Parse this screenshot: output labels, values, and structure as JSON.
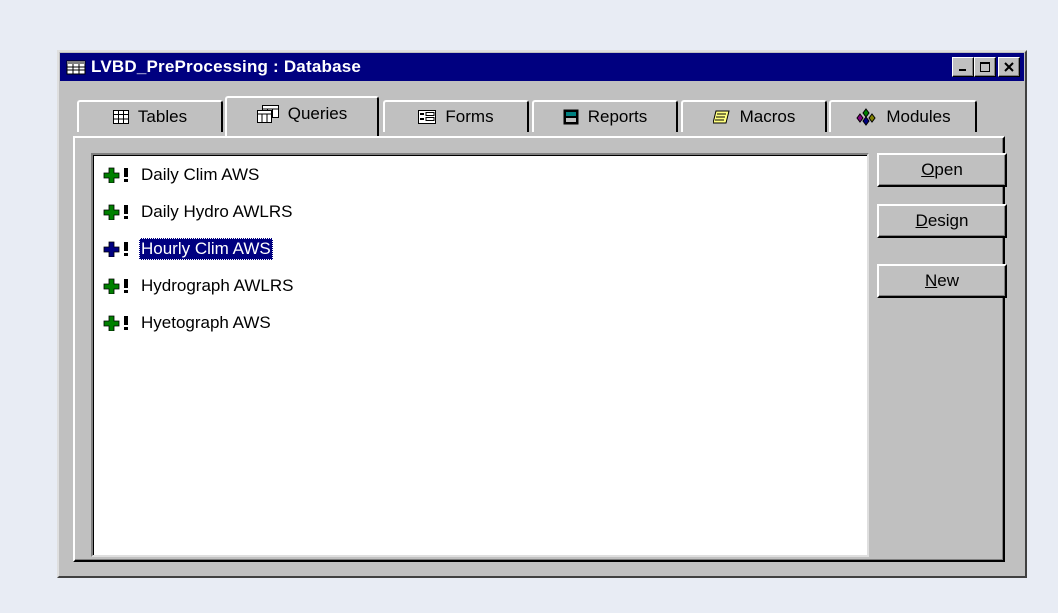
{
  "window": {
    "title": "LVBD_PreProcessing : Database",
    "controls": {
      "minimize": "minimize-icon",
      "maximize": "maximize-icon",
      "close": "close-icon"
    }
  },
  "tabs": [
    {
      "label": "Tables",
      "icon": "table-icon"
    },
    {
      "label": "Queries",
      "icon": "query-icon"
    },
    {
      "label": "Forms",
      "icon": "form-icon"
    },
    {
      "label": "Reports",
      "icon": "report-icon"
    },
    {
      "label": "Macros",
      "icon": "macro-icon"
    },
    {
      "label": "Modules",
      "icon": "module-icon"
    }
  ],
  "active_tab": "Queries",
  "queries": [
    {
      "label": "Daily Clim AWS",
      "icon": "append-query-icon"
    },
    {
      "label": "Daily Hydro AWLRS",
      "icon": "append-query-icon"
    },
    {
      "label": "Hourly Clim AWS",
      "icon": "append-query-icon"
    },
    {
      "label": "Hydrograph AWLRS",
      "icon": "append-query-icon"
    },
    {
      "label": "Hyetograph AWS",
      "icon": "append-query-icon"
    }
  ],
  "selected_query": "Hourly Clim AWS",
  "buttons": {
    "open": {
      "accel": "O",
      "rest": "pen"
    },
    "design": {
      "accel": "D",
      "rest": "esign"
    },
    "new": {
      "accel": "N",
      "rest": "ew"
    }
  },
  "colors": {
    "titlebar": "#000080",
    "face": "#c0c0c0",
    "selection": "#000080",
    "icon_plus": "#008000",
    "background": "#e8ecf4"
  }
}
